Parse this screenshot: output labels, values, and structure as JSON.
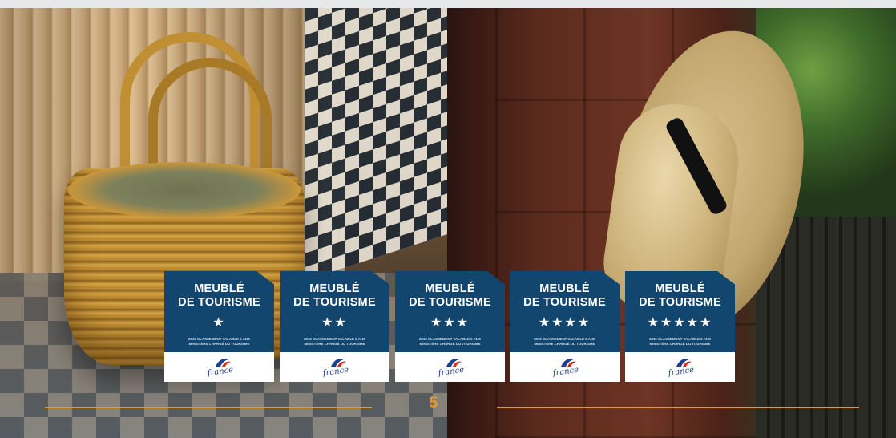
{
  "badges": [
    {
      "title_line1": "MEUBLÉ",
      "title_line2": "DE TOURISME",
      "stars": "★",
      "fine_line1": "2019 CLASSEMENT VALABLE 5 ANS",
      "fine_line2": "MINISTÈRE CHARGÉ DU TOURISME",
      "logo_text": "france"
    },
    {
      "title_line1": "MEUBLÉ",
      "title_line2": "DE TOURISME",
      "stars": "★★",
      "fine_line1": "2019 CLASSEMENT VALABLE 5 ANS",
      "fine_line2": "MINISTÈRE CHARGÉ DU TOURISME",
      "logo_text": "france"
    },
    {
      "title_line1": "MEUBLÉ",
      "title_line2": "DE TOURISME",
      "stars": "★★★",
      "fine_line1": "2019 CLASSEMENT VALABLE 5 ANS",
      "fine_line2": "MINISTÈRE CHARGÉ DU TOURISME",
      "logo_text": "france"
    },
    {
      "title_line1": "MEUBLÉ",
      "title_line2": "DE TOURISME",
      "stars": "★★★★",
      "fine_line1": "2019 CLASSEMENT VALABLE 5 ANS",
      "fine_line2": "MINISTÈRE CHARGÉ DU TOURISME",
      "logo_text": "france"
    },
    {
      "title_line1": "MEUBLÉ",
      "title_line2": "DE TOURISME",
      "stars": "★★★★★",
      "fine_line1": "2019 CLASSEMENT VALABLE 5 ANS",
      "fine_line2": "MINISTÈRE CHARGÉ DU TOURISME",
      "logo_text": "france"
    }
  ],
  "page_number": "5",
  "colors": {
    "badge_blue": "#13466f",
    "accent_orange": "#e59a26",
    "logo_blue": "#1d3f8f",
    "logo_red": "#e2231a"
  },
  "photos": {
    "left": "wicker-basket-photo",
    "right": "straw-hat-photo"
  }
}
